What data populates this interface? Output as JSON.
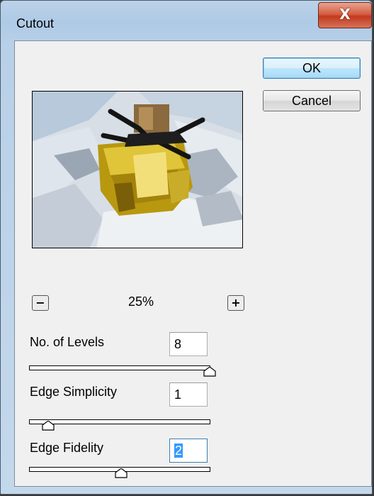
{
  "window": {
    "title": "Cutout",
    "close_glyph": "X"
  },
  "buttons": {
    "ok": "OK",
    "cancel": "Cancel"
  },
  "preview": {
    "description_icon": "perfume-bottle-preview"
  },
  "zoom": {
    "minus": "−",
    "plus": "+",
    "level": "25%"
  },
  "settings": [
    {
      "label": "No. of Levels",
      "value": "8",
      "slider_fraction": 1.0
    },
    {
      "label": "Edge Simplicity",
      "value": "1",
      "slider_fraction": 0.1
    },
    {
      "label": "Edge Fidelity",
      "value": "2",
      "slider_fraction": 0.5
    }
  ],
  "colors": {
    "title_bar": "#aecae6",
    "close_button": "#c94a2d",
    "dialog_bg": "#f0f0f0",
    "default_button": "#bee6fd",
    "selection": "#3399ff"
  }
}
